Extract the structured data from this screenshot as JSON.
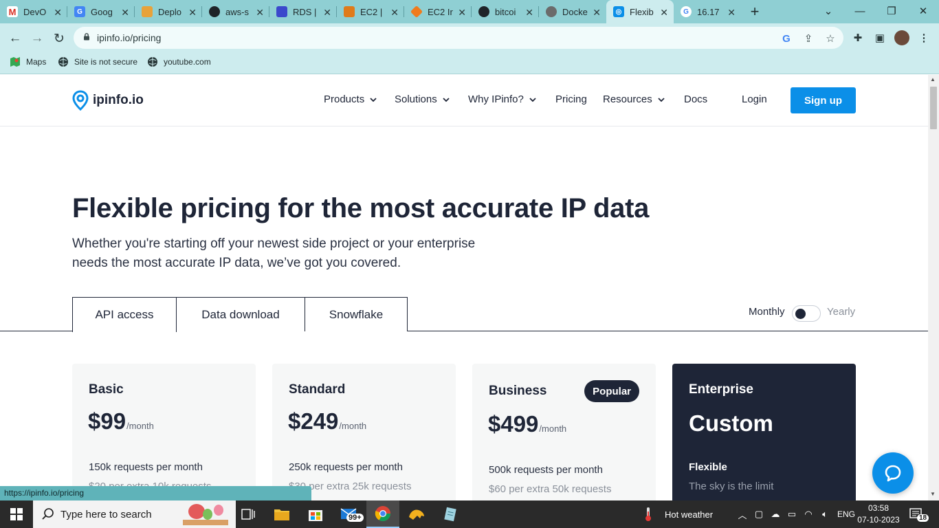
{
  "browser": {
    "tabs": [
      {
        "title": "DevO",
        "icon": "gmail-icon",
        "color": "#d93025"
      },
      {
        "title": "Goog",
        "icon": "google-translate-icon",
        "color": "#4285f4"
      },
      {
        "title": "Deplo",
        "icon": "aws-icon",
        "color": "#e8a23a"
      },
      {
        "title": "aws-s",
        "icon": "github-icon",
        "color": "#1f2328"
      },
      {
        "title": "RDS |",
        "icon": "rds-icon",
        "color": "#3b48cc"
      },
      {
        "title": "EC2 |",
        "icon": "ec2-icon",
        "color": "#e07b1a"
      },
      {
        "title": "EC2 Ir",
        "icon": "ec2-instance-icon",
        "color": "#f07b1d"
      },
      {
        "title": "bitcoi",
        "icon": "github-icon",
        "color": "#1f2328"
      },
      {
        "title": "Docke",
        "icon": "openai-icon",
        "color": "#6b6b6b"
      },
      {
        "title": "Flexib",
        "icon": "ipinfo-icon",
        "color": "#0b8fe8",
        "active": true
      },
      {
        "title": "16.17",
        "icon": "google-icon",
        "color": "#4285f4"
      }
    ],
    "url": "ipinfo.io/pricing",
    "bookmarks": [
      {
        "label": "Maps",
        "icon": "maps-icon"
      },
      {
        "label": "Site is not secure",
        "icon": "globe-icon"
      },
      {
        "label": "youtube.com",
        "icon": "globe-icon"
      }
    ],
    "status_url": "https://ipinfo.io/pricing"
  },
  "site": {
    "logo": "ipinfo.io",
    "nav": [
      {
        "label": "Products",
        "dropdown": true
      },
      {
        "label": "Solutions",
        "dropdown": true
      },
      {
        "label": "Why IPinfo?",
        "dropdown": true
      },
      {
        "label": "Pricing",
        "dropdown": false
      },
      {
        "label": "Resources",
        "dropdown": true
      },
      {
        "label": "Docs",
        "dropdown": false
      }
    ],
    "login": "Login",
    "signup": "Sign up"
  },
  "hero": {
    "title": "Flexible pricing for the most accurate IP data",
    "subtitle_line1": "Whether you're starting off your newest side project or your enterprise",
    "subtitle_line2": "needs the most accurate IP data, we’ve got you covered."
  },
  "product_tabs": [
    "API access",
    "Data download",
    "Snowflake"
  ],
  "billing": {
    "monthly": "Monthly",
    "yearly": "Yearly",
    "selected": "Monthly"
  },
  "plans": [
    {
      "name": "Basic",
      "price": "$99",
      "period": "/month",
      "requests": "150k requests per month",
      "extra": "$20 per extra 10k requests"
    },
    {
      "name": "Standard",
      "price": "$249",
      "period": "/month",
      "requests": "250k requests per month",
      "extra": "$30 per extra 25k requests"
    },
    {
      "name": "Business",
      "price": "$499",
      "period": "/month",
      "badge": "Popular",
      "requests": "500k requests per month",
      "extra": "$60 per extra 50k requests"
    },
    {
      "name": "Enterprise",
      "price": "Custom",
      "feature": "Flexible",
      "feature_sub": "The sky is the limit"
    }
  ],
  "taskbar": {
    "search_placeholder": "Type here to search",
    "mail_badge": "99+",
    "weather": "Hot weather",
    "language": "ENG",
    "time": "03:58",
    "date": "07-10-2023",
    "notifications": "18"
  },
  "colors": {
    "brand_blue": "#0b8fe8",
    "navy": "#1e2537",
    "chrome_teal": "#8fcfd3"
  }
}
